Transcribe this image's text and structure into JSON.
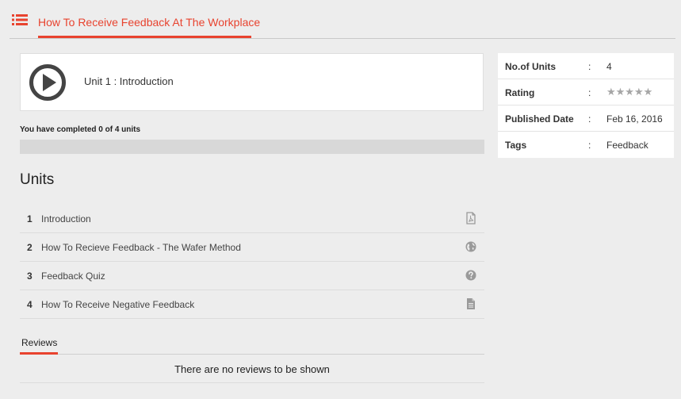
{
  "header": {
    "menu_icon": "list-icon",
    "course_title": "How To Receive Feedback At The Workplace",
    "accent_color": "#e8432f"
  },
  "current_unit": {
    "icon": "play-circle-icon",
    "title": "Unit 1 : Introduction"
  },
  "progress": {
    "text": "You have completed 0 of 4 units",
    "completed": 0,
    "total": 4
  },
  "units_section": {
    "heading": "Units",
    "items": [
      {
        "number": "1",
        "name": "Introduction",
        "icon": "pdf-file-icon"
      },
      {
        "number": "2",
        "name": "How To Recieve Feedback - The Wafer Method",
        "icon": "globe-icon"
      },
      {
        "number": "3",
        "name": "Feedback Quiz",
        "icon": "question-circle-icon"
      },
      {
        "number": "4",
        "name": "How To Receive Negative Feedback",
        "icon": "document-icon"
      }
    ]
  },
  "reviews": {
    "tab_label": "Reviews",
    "empty_message": "There are no reviews to be shown"
  },
  "info": {
    "separator": ":",
    "rows": [
      {
        "label": "No.of Units",
        "value": "4"
      },
      {
        "label": "Rating",
        "value": "★★★★★",
        "rating": 0,
        "max_rating": 5
      },
      {
        "label": "Published Date",
        "value": "Feb 16, 2016"
      },
      {
        "label": "Tags",
        "value": "Feedback"
      }
    ]
  }
}
